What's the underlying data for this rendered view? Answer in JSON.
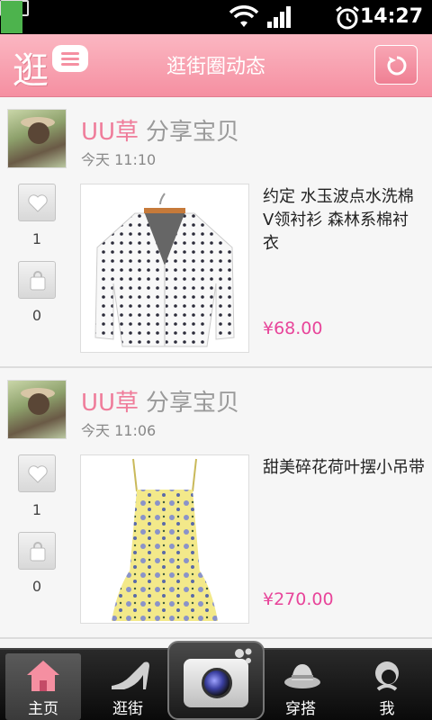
{
  "status_bar": {
    "battery_percent": "59",
    "time": "14:27"
  },
  "header": {
    "title": "逛街圈动态",
    "logo_text": "逛"
  },
  "posts": [
    {
      "user": "UU草",
      "action": "分享宝贝",
      "time": "今天 11:10",
      "likes": "1",
      "bag_count": "0",
      "product_name": "约定 水玉波点水洗棉V领衬衫 森林系棉衬衣",
      "price": "¥68.00",
      "image_icon": "polka-dot-shirt"
    },
    {
      "user": "UU草",
      "action": "分享宝贝",
      "time": "今天 11:06",
      "likes": "1",
      "bag_count": "0",
      "product_name": "甜美碎花荷叶摆小吊带",
      "price": "¥270.00",
      "image_icon": "floral-camisole"
    }
  ],
  "tabbar": {
    "home": "主页",
    "browse": "逛街",
    "outfit": "穿搭",
    "me": "我"
  },
  "colors": {
    "header_pink": "#f58fa1",
    "username_pink": "#ef7c9a",
    "price_pink": "#e8459a"
  }
}
